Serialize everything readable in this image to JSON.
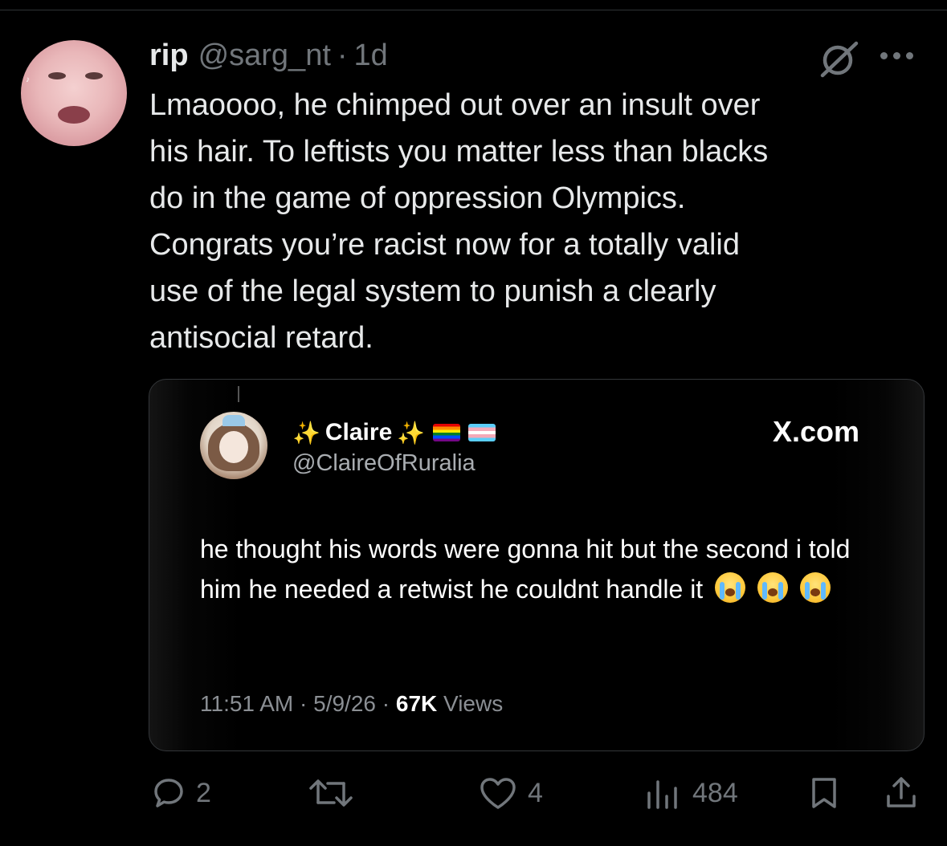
{
  "post": {
    "author_name": "rip",
    "author_handle": "@sarg_nt",
    "separator": "·",
    "time": "1d",
    "text": "Lmaoooo, he chimped out over an insult over\nhis hair. To leftists you matter less than blacks\ndo in the game of oppression Olympics.\nCongrats you’re racist now for a totally valid\nuse of the legal system to punish a clearly\nantisocial retard."
  },
  "quote": {
    "name": "Claire",
    "handle": "@ClaireOfRuralia",
    "site": "X.com",
    "text": "he thought his words were gonna hit but the second i told him he needed a retwist he couldnt handle it",
    "time": "11:51 AM",
    "date": "5/9/26",
    "views_count": "67K",
    "views_label": "Views"
  },
  "actions": {
    "replies": "2",
    "likes": "4",
    "views": "484"
  },
  "icons": {
    "grok": "grok-icon",
    "more": "more-icon",
    "reply": "reply-icon",
    "retweet": "retweet-icon",
    "like": "like-icon",
    "views": "views-icon",
    "bookmark": "bookmark-icon",
    "share": "share-icon"
  },
  "colors": {
    "background": "#000000",
    "text": "#e7e9ea",
    "muted": "#71767b"
  }
}
